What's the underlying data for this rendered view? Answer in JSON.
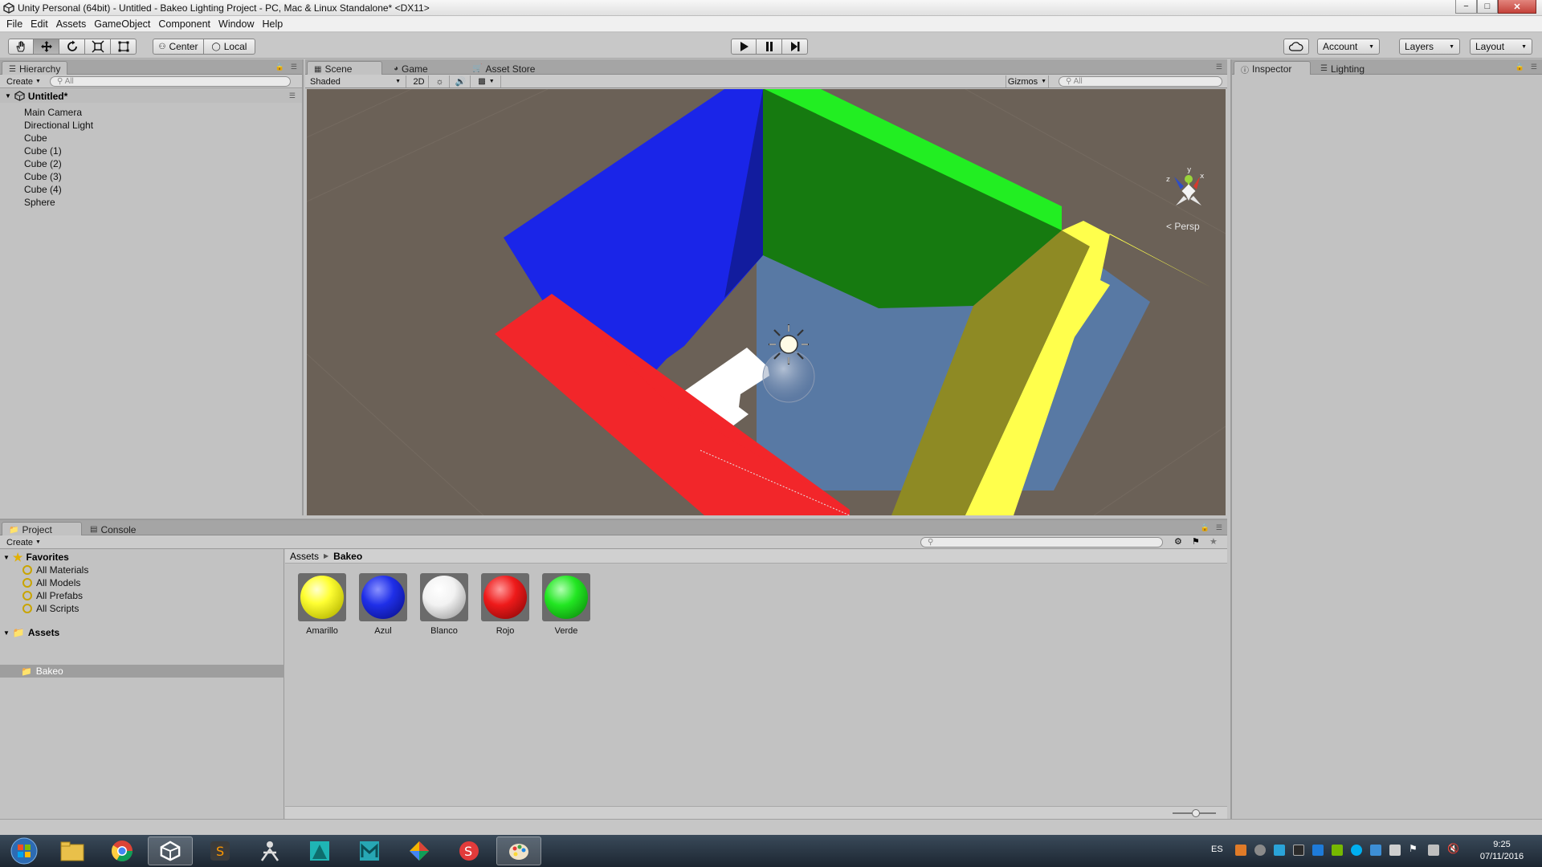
{
  "window": {
    "title": "Unity Personal (64bit) - Untitled - Bakeo Lighting Project - PC, Mac & Linux Standalone* <DX11>",
    "min_glyph": "−",
    "max_glyph": "□",
    "close_glyph": "✕"
  },
  "menu": [
    "File",
    "Edit",
    "Assets",
    "GameObject",
    "Component",
    "Window",
    "Help"
  ],
  "toolbar": {
    "pivot_mode": "Center",
    "pivot_rotation": "Local",
    "account_label": "Account",
    "layers_label": "Layers",
    "layout_label": "Layout"
  },
  "hierarchy": {
    "tab_label": "Hierarchy",
    "create_label": "Create",
    "search_placeholder": "All",
    "scene_name": "Untitled*",
    "items": [
      "Main Camera",
      "Directional Light",
      "Cube",
      "Cube (1)",
      "Cube (2)",
      "Cube (3)",
      "Cube (4)",
      "Sphere"
    ]
  },
  "scene_view": {
    "tabs": [
      "Scene",
      "Game",
      "Asset Store"
    ],
    "shading_mode": "Shaded",
    "mode_2d_label": "2D",
    "gizmos_label": "Gizmos",
    "search_placeholder": "All",
    "projection_label": "Persp",
    "colors": {
      "background": "#6b6157",
      "blue_wall": "#1a25e8",
      "green_wall": "#167a10",
      "red_wall": "#f2262a",
      "yellow_wall": "#ffff4c",
      "floor": "#5879a4"
    }
  },
  "inspector": {
    "tabs": [
      "Inspector",
      "Lighting"
    ]
  },
  "project": {
    "tabs": [
      "Project",
      "Console"
    ],
    "create_label": "Create",
    "favorites_label": "Favorites",
    "favorites": [
      "All Materials",
      "All Models",
      "All Prefabs",
      "All Scripts"
    ],
    "assets_label": "Assets",
    "folders": [
      "Bakeo"
    ],
    "breadcrumb": [
      "Assets",
      "Bakeo"
    ],
    "materials": [
      {
        "name": "Amarillo",
        "color": "#ffff33"
      },
      {
        "name": "Azul",
        "color": "#1f2fe8"
      },
      {
        "name": "Blanco",
        "color": "#ffffff"
      },
      {
        "name": "Rojo",
        "color": "#ee1a1a"
      },
      {
        "name": "Verde",
        "color": "#22e622"
      }
    ]
  },
  "taskbar": {
    "language": "ES",
    "time": "9:25",
    "date": "07/11/2016"
  }
}
